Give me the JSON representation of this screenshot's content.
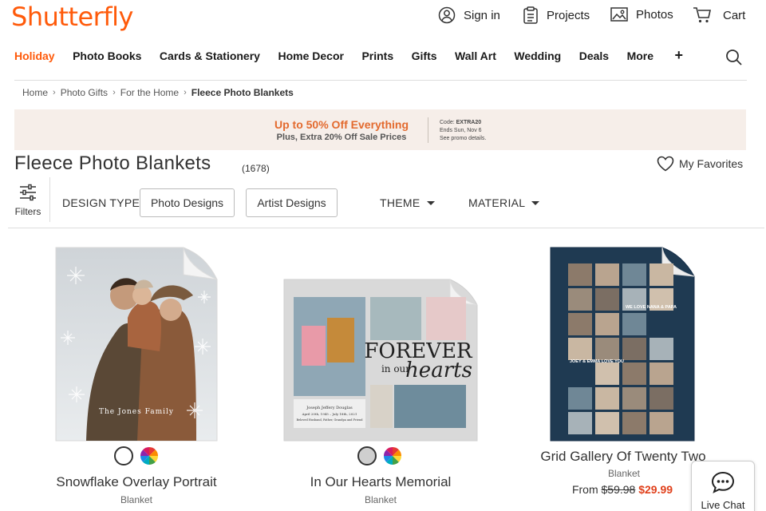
{
  "brand": {
    "logo": "Shutterfly",
    "accent": "#ff5a0a"
  },
  "utility_nav": {
    "signin": "Sign in",
    "projects": "Projects",
    "photos": "Photos",
    "cart": "Cart"
  },
  "main_nav": {
    "items": [
      "Holiday",
      "Photo Books",
      "Cards & Stationery",
      "Home Decor",
      "Prints",
      "Gifts",
      "Wall Art",
      "Wedding",
      "Deals",
      "More"
    ],
    "more_icon": "+"
  },
  "breadcrumb": [
    "Home",
    "Photo Gifts",
    "For the Home",
    "Fleece Photo Blankets"
  ],
  "promo": {
    "headline": "Up to 50% Off Everything",
    "sub": "Plus, Extra 20% Off Sale Prices",
    "code_label": "Code: ",
    "code": "EXTRA20",
    "ends": "Ends Sun, Nov 6",
    "details": "See promo details.",
    "background": "#f6eee9",
    "headline_color": "#e36a2e"
  },
  "page": {
    "title": "Fleece Photo Blankets",
    "count": "(1678)",
    "favorites": "My Favorites"
  },
  "filters": {
    "label": "Filters",
    "design_type_label": "DESIGN TYPE",
    "design_options": [
      "Photo Designs",
      "Artist Designs"
    ],
    "theme": "THEME",
    "material": "MATERIAL"
  },
  "products": [
    {
      "name": "Snowflake Overlay Portrait",
      "type": "Blanket",
      "overlay_text": "The Jones Family"
    },
    {
      "name": "In Our Hearts Memorial",
      "type": "Blanket",
      "overlay_title_1": "FOREVER",
      "overlay_title_2": "in our",
      "overlay_title_3": "hearts",
      "caption_1": "Joseph Jeffery Douglas",
      "caption_2": "April 20th, 1945 – July 18th, 2021",
      "caption_3": "Beloved Husband, Father, Grandpa and Friend"
    },
    {
      "name": "Grid Gallery Of Twenty Two",
      "type": "Blanket",
      "price_label": "From",
      "price_orig": "$59.98",
      "price_sale": "$29.99",
      "overlay_1": "WE LOVE NANA & PAPA",
      "overlay_2": "JOEY & EMMA LOVE YOU"
    }
  ],
  "chat": {
    "label": "Live Chat"
  }
}
